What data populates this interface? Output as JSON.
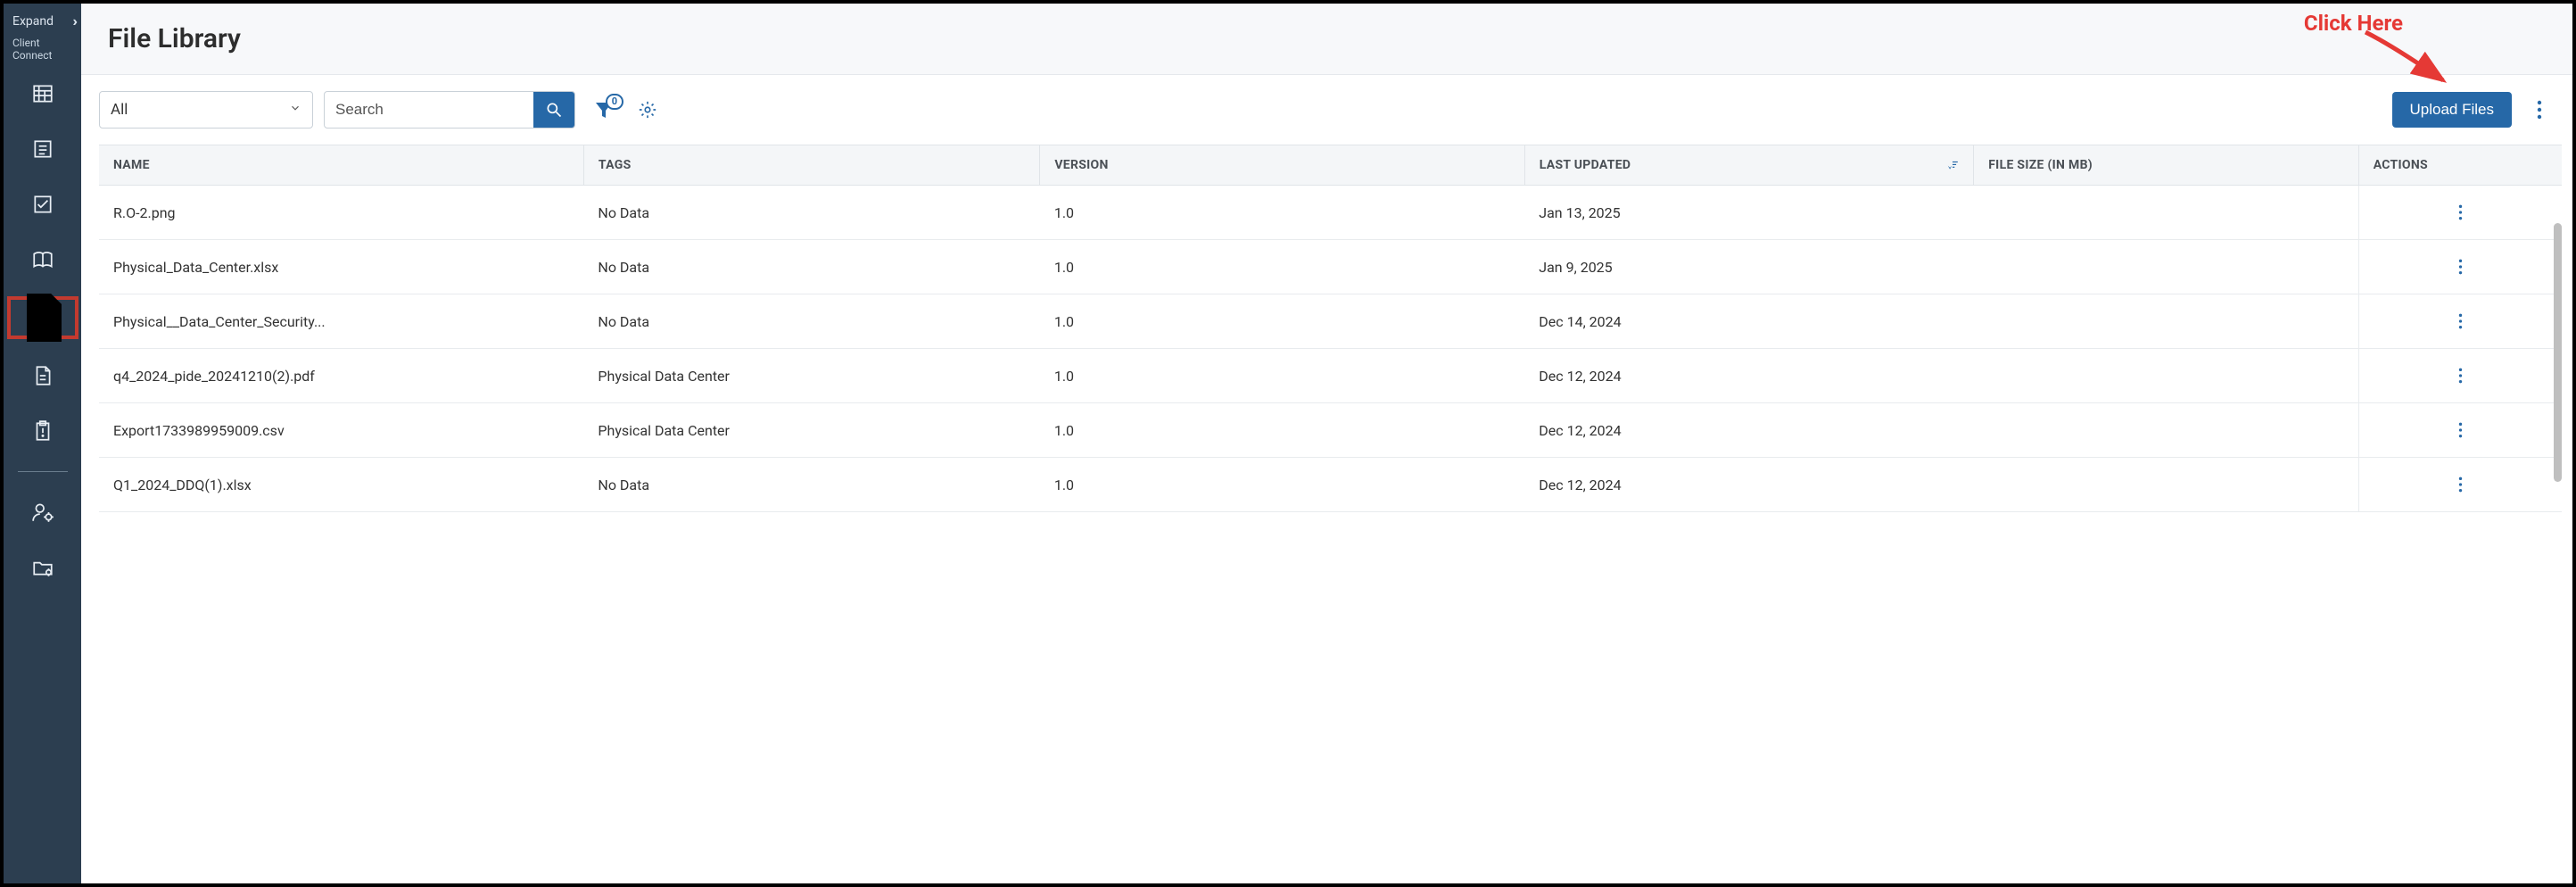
{
  "sidebar": {
    "expand_label": "Expand",
    "brand_line1": "Client",
    "brand_line2": "Connect",
    "icons": [
      {
        "name": "building-icon"
      },
      {
        "name": "list-icon"
      },
      {
        "name": "checklist-icon"
      },
      {
        "name": "book-icon"
      },
      {
        "name": "file-check-icon",
        "selected": true
      },
      {
        "name": "document-icon"
      },
      {
        "name": "clipboard-alert-icon"
      },
      {
        "divider": true
      },
      {
        "name": "user-settings-icon"
      },
      {
        "name": "folder-config-icon"
      }
    ]
  },
  "page": {
    "title": "File Library"
  },
  "toolbar": {
    "filter_dropdown": "All",
    "search_placeholder": "Search",
    "filter_badge": "0",
    "upload_label": "Upload Files"
  },
  "table": {
    "columns": {
      "name": "NAME",
      "tags": "TAGS",
      "version": "VERSION",
      "last_updated": "LAST UPDATED",
      "file_size": "FILE SIZE (IN MB)",
      "actions": "ACTIONS"
    },
    "rows": [
      {
        "name": "R.O-2.png",
        "tags": "No Data",
        "version": "1.0",
        "last_updated": "Jan 13, 2025",
        "file_size": ""
      },
      {
        "name": "Physical_Data_Center.xlsx",
        "tags": "No Data",
        "version": "1.0",
        "last_updated": "Jan 9, 2025",
        "file_size": ""
      },
      {
        "name": "Physical__Data_Center_Security...",
        "tags": "No Data",
        "version": "1.0",
        "last_updated": "Dec 14, 2024",
        "file_size": ""
      },
      {
        "name": "q4_2024_pide_20241210(2).pdf",
        "tags": "Physical Data Center",
        "version": "1.0",
        "last_updated": "Dec 12, 2024",
        "file_size": ""
      },
      {
        "name": "Export1733989959009.csv",
        "tags": "Physical Data Center",
        "version": "1.0",
        "last_updated": "Dec 12, 2024",
        "file_size": ""
      },
      {
        "name": "Q1_2024_DDQ(1).xlsx",
        "tags": "No Data",
        "version": "1.0",
        "last_updated": "Dec 12, 2024",
        "file_size": ""
      }
    ]
  },
  "annotation": {
    "label": "Click Here"
  }
}
